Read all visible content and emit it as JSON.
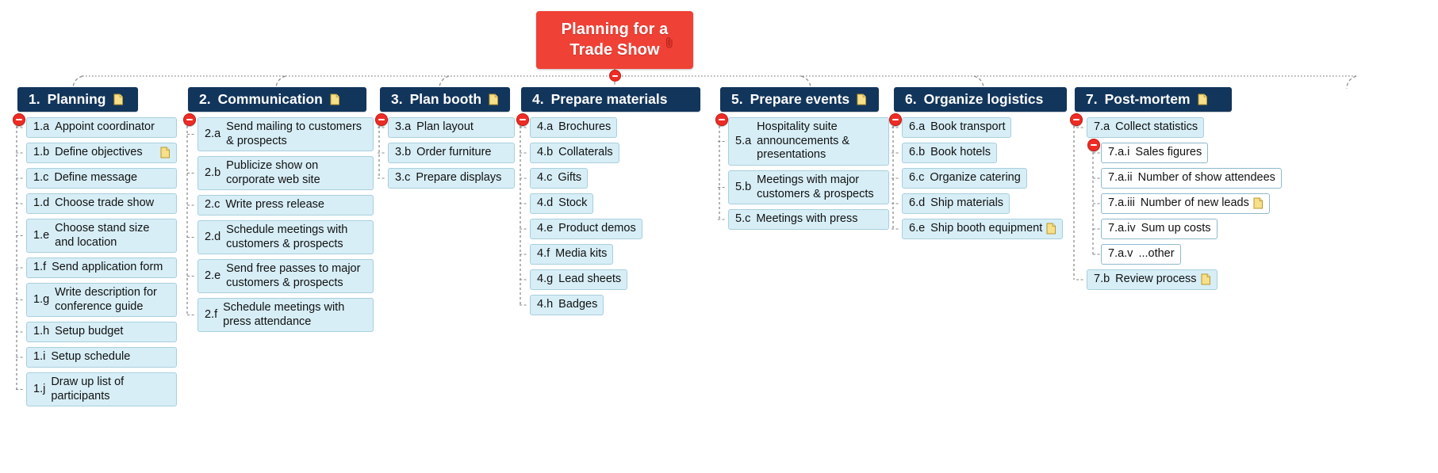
{
  "root": {
    "label": "Planning for a\nTrade Show",
    "color": "#ef4136",
    "attachment_icon": "paperclip-icon"
  },
  "theme": {
    "branch_header_color": "#12355b",
    "node_fill": "#d7eef6",
    "node_border": "#a9cfdd",
    "subnode_fill": "#ffffff",
    "connector_color": "#8a8a8a",
    "collapse_color": "#ee2b24"
  },
  "branches": [
    {
      "num": "1.",
      "title": "Planning",
      "note": true,
      "children": [
        {
          "idx": "1.a",
          "text": "Appoint coordinator",
          "note": false
        },
        {
          "idx": "1.b",
          "text": "Define objectives",
          "note": true
        },
        {
          "idx": "1.c",
          "text": "Define message",
          "note": false
        },
        {
          "idx": "1.d",
          "text": "Choose trade show",
          "note": false
        },
        {
          "idx": "1.e",
          "text": "Choose stand size and location",
          "note": false
        },
        {
          "idx": "1.f",
          "text": "Send application form",
          "note": false
        },
        {
          "idx": "1.g",
          "text": "Write description for conference guide",
          "note": false
        },
        {
          "idx": "1.h",
          "text": "Setup budget",
          "note": false
        },
        {
          "idx": "1.i",
          "text": "Setup schedule",
          "note": false
        },
        {
          "idx": "1.j",
          "text": "Draw up list of participants",
          "note": false
        }
      ]
    },
    {
      "num": "2.",
      "title": "Communication",
      "note": true,
      "children": [
        {
          "idx": "2.a",
          "text": "Send mailing to customers & prospects",
          "note": false
        },
        {
          "idx": "2.b",
          "text": "Publicize show on corporate web site",
          "note": false
        },
        {
          "idx": "2.c",
          "text": "Write press release",
          "note": false
        },
        {
          "idx": "2.d",
          "text": "Schedule meetings with customers & prospects",
          "note": false
        },
        {
          "idx": "2.e",
          "text": "Send free passes to major customers & prospects",
          "note": false
        },
        {
          "idx": "2.f",
          "text": "Schedule meetings with press attendance",
          "note": false
        }
      ]
    },
    {
      "num": "3.",
      "title": "Plan booth",
      "note": true,
      "children": [
        {
          "idx": "3.a",
          "text": "Plan layout",
          "note": false
        },
        {
          "idx": "3.b",
          "text": "Order furniture",
          "note": false
        },
        {
          "idx": "3.c",
          "text": "Prepare displays",
          "note": false
        }
      ]
    },
    {
      "num": "4.",
      "title": "Prepare materials",
      "note": false,
      "children": [
        {
          "idx": "4.a",
          "text": "Brochures",
          "note": false
        },
        {
          "idx": "4.b",
          "text": "Collaterals",
          "note": false
        },
        {
          "idx": "4.c",
          "text": "Gifts",
          "note": false
        },
        {
          "idx": "4.d",
          "text": "Stock",
          "note": false
        },
        {
          "idx": "4.e",
          "text": "Product demos",
          "note": false
        },
        {
          "idx": "4.f",
          "text": "Media kits",
          "note": false
        },
        {
          "idx": "4.g",
          "text": "Lead sheets",
          "note": false
        },
        {
          "idx": "4.h",
          "text": "Badges",
          "note": false
        }
      ]
    },
    {
      "num": "5.",
      "title": "Prepare events",
      "note": true,
      "children": [
        {
          "idx": "5.a",
          "text": "Hospitality suite announcements & presentations",
          "note": false
        },
        {
          "idx": "5.b",
          "text": "Meetings with major customers & prospects",
          "note": false
        },
        {
          "idx": "5.c",
          "text": "Meetings with press",
          "note": false
        }
      ]
    },
    {
      "num": "6.",
      "title": "Organize logistics",
      "note": false,
      "children": [
        {
          "idx": "6.a",
          "text": "Book transport",
          "note": false
        },
        {
          "idx": "6.b",
          "text": "Book hotels",
          "note": false
        },
        {
          "idx": "6.c",
          "text": "Organize catering",
          "note": false
        },
        {
          "idx": "6.d",
          "text": "Ship materials",
          "note": false
        },
        {
          "idx": "6.e",
          "text": "Ship booth equipment",
          "note": true
        }
      ]
    },
    {
      "num": "7.",
      "title": "Post-mortem",
      "note": true,
      "children": [
        {
          "idx": "7.a",
          "text": "Collect statistics",
          "note": false
        },
        {
          "idx": "7.b",
          "text": "Review process",
          "note": true
        }
      ],
      "grandchildren": [
        {
          "idx": "7.a.i",
          "text": "Sales figures",
          "note": false
        },
        {
          "idx": "7.a.ii",
          "text": "Number of show attendees",
          "note": false
        },
        {
          "idx": "7.a.iii",
          "text": "Number of new leads",
          "note": true
        },
        {
          "idx": "7.a.iv",
          "text": "Sum up costs",
          "note": false
        },
        {
          "idx": "7.a.v",
          "text": "...other",
          "note": false
        }
      ]
    }
  ]
}
